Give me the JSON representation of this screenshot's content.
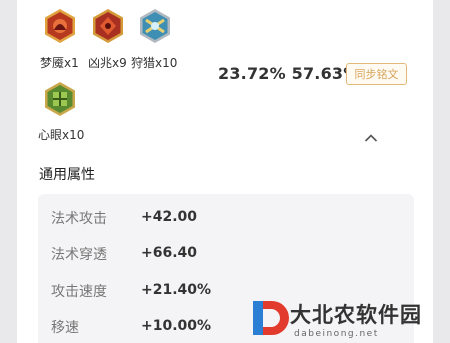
{
  "runes": [
    {
      "label": "梦魇x1",
      "icon": "nightmare-rune-icon",
      "color": "#c8502a"
    },
    {
      "label": "凶兆x9",
      "icon": "omen-rune-icon",
      "color": "#b8402a"
    },
    {
      "label": "狩猎x10",
      "icon": "hunt-rune-icon",
      "color": "#4aa6c8"
    },
    {
      "label": "心眼x10",
      "icon": "mind-eye-rune-icon",
      "color": "#6a9a3a"
    }
  ],
  "summary": {
    "stat_a": "23.72%",
    "stat_b": "57.63%",
    "sync_button": "同步铭文"
  },
  "section": {
    "title": "通用属性"
  },
  "attributes": [
    {
      "name": "法术攻击",
      "value": "+42.00"
    },
    {
      "name": "法术穿透",
      "value": "+66.40"
    },
    {
      "name": "攻击速度",
      "value": "+21.40%"
    },
    {
      "name": "移速",
      "value": "+10.00%"
    }
  ],
  "watermark": {
    "text": "大北农软件园",
    "sub": "dabeinong.net"
  },
  "colors": {
    "accent_border": "#e3b97a",
    "accent_text": "#d8a45a"
  }
}
